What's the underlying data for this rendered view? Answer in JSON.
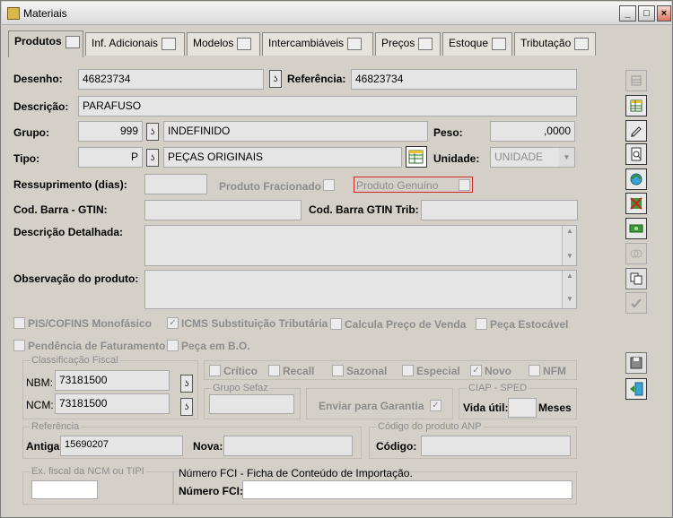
{
  "window": {
    "title": "Materiais",
    "min": "_",
    "max": "□",
    "close": "×"
  },
  "tabs": [
    {
      "label": "Produtos"
    },
    {
      "label": "Inf. Adicionais"
    },
    {
      "label": "Modelos"
    },
    {
      "label": "Intercambiáveis"
    },
    {
      "label": "Preços"
    },
    {
      "label": "Estoque"
    },
    {
      "label": "Tributação"
    }
  ],
  "form": {
    "desenho_label": "Desenho:",
    "desenho": "46823734",
    "referencia_label": "Referência:",
    "referencia": "46823734",
    "descricao_label": "Descrição:",
    "descricao": "PARAFUSO",
    "grupo_label": "Grupo:",
    "grupo_code": "999",
    "grupo_desc": "INDEFINIDO",
    "peso_label": "Peso:",
    "peso": ",0000",
    "tipo_label": "Tipo:",
    "tipo_code": "P",
    "tipo_desc": "PEÇAS ORIGINAIS",
    "unidade_label": "Unidade:",
    "unidade": "UNIDADE",
    "ressup_label": "Ressuprimento (dias):",
    "ressup": "",
    "fracionado_label": "Produto Fracionado",
    "genuino_label": "Produto Genuíno",
    "gtin_label": "Cod. Barra - GTIN:",
    "gtin": "",
    "gtin_trib_label": "Cod. Barra GTIN Trib:",
    "gtin_trib": "",
    "desc_det_label": "Descrição Detalhada:",
    "obs_label": "Observação do produto:",
    "pis_label": "PIS/COFINS Monofásico",
    "icms_label": "ICMS Substituição Tributária",
    "calcula_label": "Calcula Preço de Venda",
    "estocavel_label": "Peça Estocável",
    "pendencia_label": "Pendência de Faturamento",
    "peca_bo_label": "Peça em B.O.",
    "classif_title": "Classificação Fiscal",
    "nbm_label": "NBM:",
    "nbm": "73181500",
    "ncm_label": "NCM:",
    "ncm": "73181500",
    "critico_label": "Crítico",
    "recall_label": "Recall",
    "sazonal_label": "Sazonal",
    "especial_label": "Especial",
    "novo_label": "Novo",
    "nfm_label": "NFM",
    "grupo_sefaz_title": "Grupo Sefaz",
    "enviar_label": "Enviar para Garantia",
    "ciap_title": "CIAP - SPED",
    "vida_label": "Vida útil:",
    "meses_label": "Meses",
    "referencia_title": "Referência",
    "antiga_label": "Antiga:",
    "antiga": "15690207",
    "nova_label": "Nova:",
    "nova": "",
    "anp_title": "Código do produto ANP",
    "codigo_label": "Código:",
    "codigo": "",
    "ex_fiscal_title": "Ex. fiscal da NCM ou TIPI",
    "fci_note": "Número  FCI - Ficha de Conteúdo de Importação.",
    "fci_label": "Número FCI:",
    "fci": ""
  },
  "side_buttons": [
    "list-icon",
    "grid-icon",
    "pencil-icon",
    "preview-icon",
    "refresh-icon",
    "delete-icon",
    "money-icon",
    "copy-icon",
    "duplicate-icon",
    "check-icon",
    "save-icon",
    "exit-icon"
  ]
}
